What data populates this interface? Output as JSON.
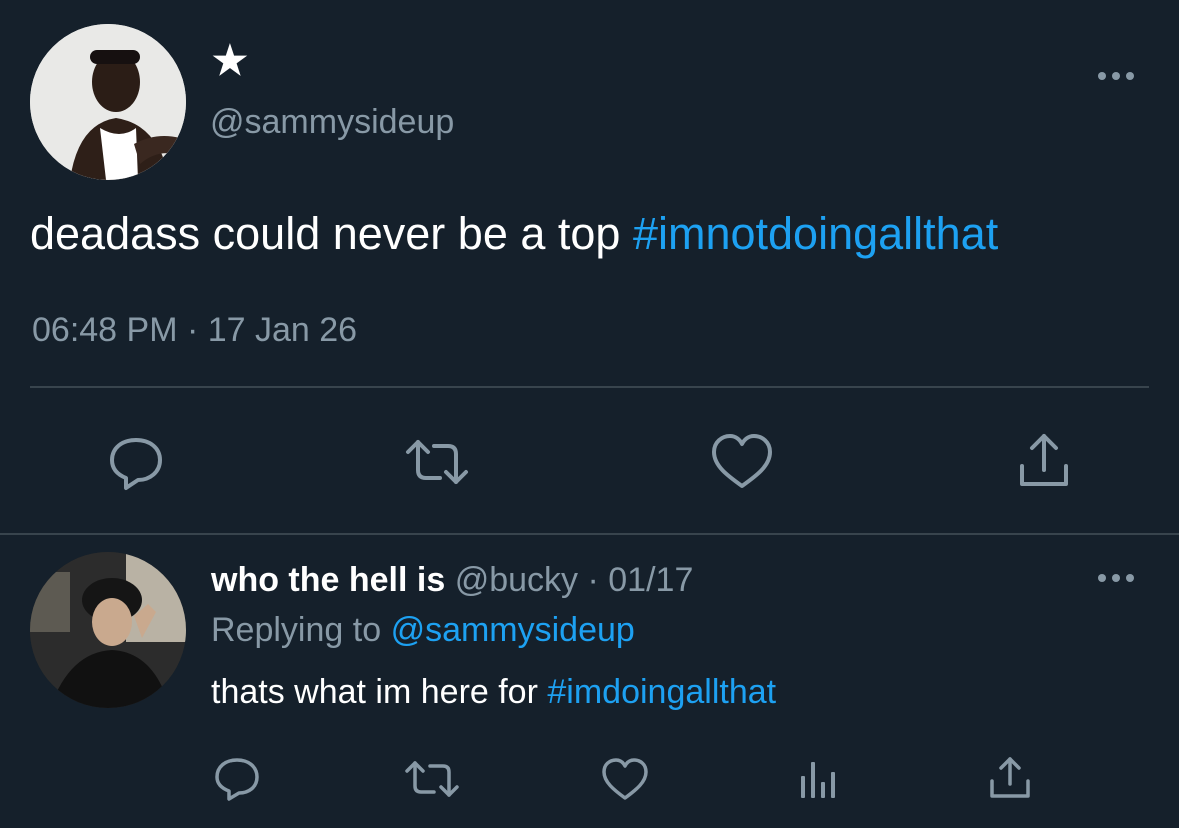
{
  "main_tweet": {
    "display_name": "★",
    "handle": "@sammysideup",
    "text": "deadass could never be a top",
    "hashtag": "#imnotdoingallthat",
    "timestamp": "06:48 PM · 17 Jan 26"
  },
  "reply": {
    "display_name": "who the hell is",
    "handle": "@bucky",
    "date": "· 01/17",
    "replying_prefix": "Replying to",
    "replying_handle": "@sammysideup",
    "text": "thats what im here for",
    "hashtag": "#imdoingallthat"
  },
  "colors": {
    "background": "#15202b",
    "accent": "#1da1f2",
    "muted": "#8899a6",
    "divider": "#38444d"
  },
  "icons": {
    "main_actions": [
      "reply-icon",
      "retweet-icon",
      "like-icon",
      "share-icon"
    ],
    "reply_actions": [
      "reply-icon",
      "retweet-icon",
      "like-icon",
      "analytics-icon",
      "share-icon"
    ],
    "more": "more-options-icon"
  }
}
